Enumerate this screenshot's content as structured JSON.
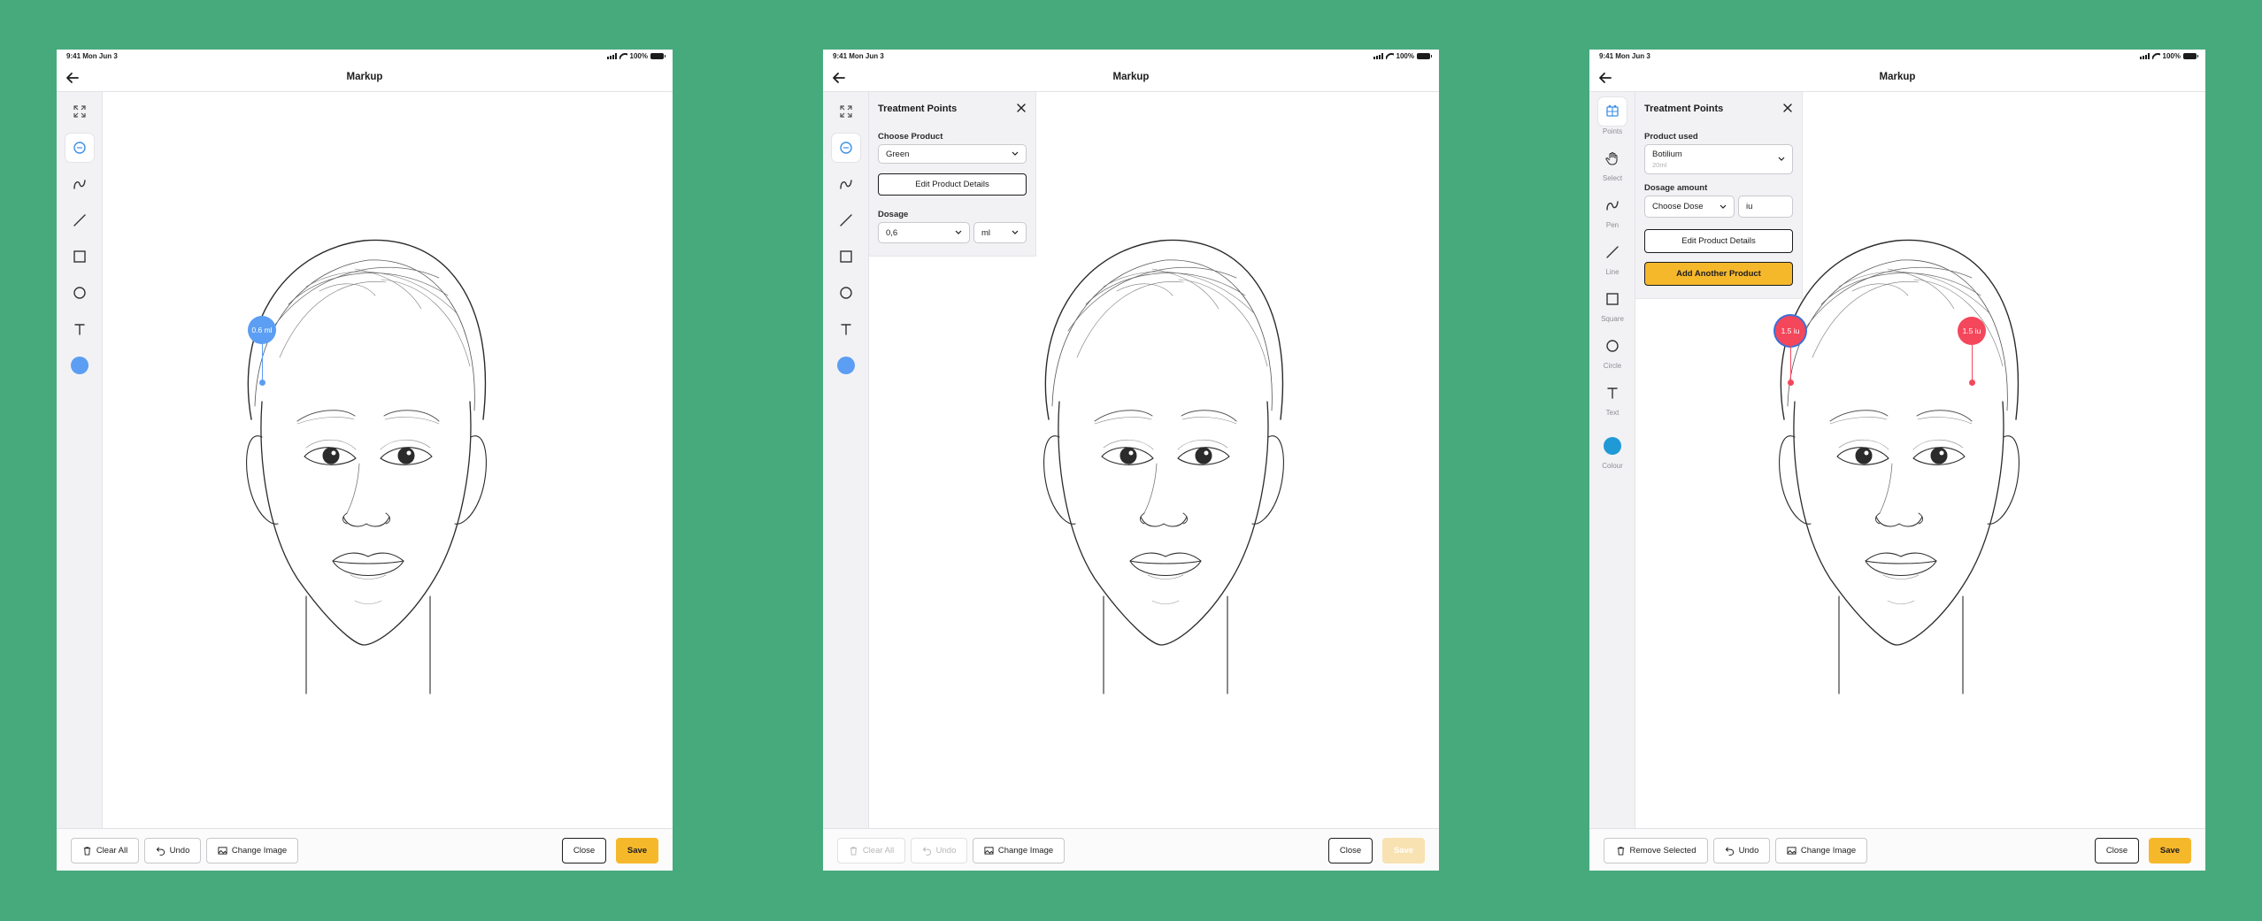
{
  "status": {
    "time": "9:41  Mon Jun 3",
    "battery": "100%"
  },
  "nav": {
    "title": "Markup"
  },
  "colors": {
    "background": "#47aa7d",
    "accent_blue": "#5b9ef3",
    "accent_red": "#f4475b",
    "accent_yellow": "#f6b82b",
    "colour_swatch_3": "#1f9ad6"
  },
  "tools": {
    "points": "Points",
    "select": "Select",
    "pen": "Pen",
    "line": "Line",
    "square": "Square",
    "circle": "Circle",
    "text": "Text",
    "colour": "Colour"
  },
  "panel2": {
    "title": "Treatment Points",
    "choose_product_label": "Choose Product",
    "product_value": "Green",
    "edit_button": "Edit Product Details",
    "dosage_label": "Dosage",
    "dosage_value": "0,6",
    "unit_value": "ml"
  },
  "panel3": {
    "title": "Treatment Points",
    "product_used_label": "Product used",
    "product_value": "Botilium",
    "product_sub": "20ml",
    "dosage_label": "Dosage amount",
    "dose_placeholder": "Choose Dose",
    "unit_value": "iu",
    "edit_button": "Edit Product Details",
    "add_button": "Add Another Product"
  },
  "markers": {
    "s1_marker": "0.6 ml",
    "s3_marker_left": "1.5 iu",
    "s3_marker_right": "1.5 iu"
  },
  "bottom": {
    "clear_all": "Clear All",
    "undo": "Undo",
    "change_image": "Change Image",
    "remove_selected": "Remove Selected",
    "close": "Close",
    "save": "Save"
  }
}
